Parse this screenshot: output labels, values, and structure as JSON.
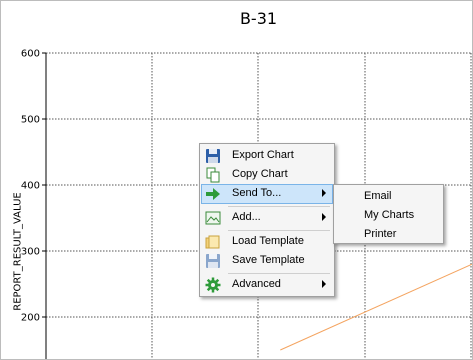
{
  "chart": {
    "title": "B-31",
    "ylabel": "REPORT_RESULT_VALUE"
  },
  "chart_data": {
    "type": "line",
    "title": "B-31",
    "xlabel": "",
    "ylabel": "REPORT_RESULT_VALUE",
    "ylim": [
      150,
      600
    ],
    "yticks": [
      200,
      300,
      400,
      500,
      600
    ],
    "grid": true,
    "series": [
      {
        "color": "#f4a460",
        "points": [
          [
            0.55,
            150
          ],
          [
            1.0,
            280
          ]
        ]
      }
    ]
  },
  "context_menu": {
    "items": [
      {
        "label": "Export Chart",
        "icon": "save-icon"
      },
      {
        "label": "Copy Chart",
        "icon": "copy-icon"
      },
      {
        "label": "Send To...",
        "icon": "send-arrow-icon",
        "submenu": true,
        "highlighted": true
      },
      {
        "label": "Add...",
        "icon": "image-icon",
        "submenu": true
      },
      {
        "label": "Load Template",
        "icon": "folder-icon"
      },
      {
        "label": "Save Template",
        "icon": "save-template-icon"
      },
      {
        "label": "Advanced",
        "icon": "gear-icon",
        "submenu": true
      }
    ]
  },
  "send_to_submenu": {
    "items": [
      "Email",
      "My Charts",
      "Printer"
    ]
  },
  "colors": {
    "grid": "#555555",
    "line": "#f4a460",
    "highlight": "#cde5fa"
  }
}
